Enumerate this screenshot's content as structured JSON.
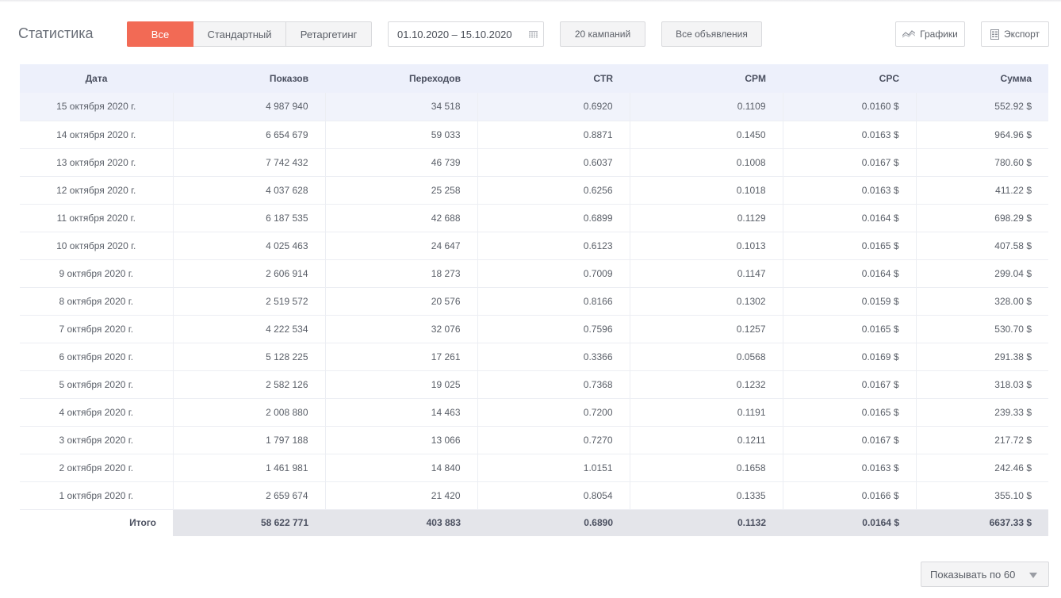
{
  "page_title": "Статистика",
  "filters": {
    "segments": [
      {
        "label": "Все",
        "active": true
      },
      {
        "label": "Стандартный",
        "active": false
      },
      {
        "label": "Ретаргетинг",
        "active": false
      }
    ],
    "date_range": "01.10.2020 – 15.10.2020",
    "campaigns_label": "20 кампаний",
    "ads_label": "Все объявления"
  },
  "toolbar": {
    "charts_label": "Графики",
    "export_label": "Экспорт"
  },
  "table": {
    "columns": [
      "Дата",
      "Показов",
      "Переходов",
      "CTR",
      "CPM",
      "CPC",
      "Сумма"
    ],
    "rows": [
      [
        "15 октября 2020 г.",
        "4 987 940",
        "34 518",
        "0.6920",
        "0.1109",
        "0.0160 $",
        "552.92 $"
      ],
      [
        "14 октября 2020 г.",
        "6 654 679",
        "59 033",
        "0.8871",
        "0.1450",
        "0.0163 $",
        "964.96 $"
      ],
      [
        "13 октября 2020 г.",
        "7 742 432",
        "46 739",
        "0.6037",
        "0.1008",
        "0.0167 $",
        "780.60 $"
      ],
      [
        "12 октября 2020 г.",
        "4 037 628",
        "25 258",
        "0.6256",
        "0.1018",
        "0.0163 $",
        "411.22 $"
      ],
      [
        "11 октября 2020 г.",
        "6 187 535",
        "42 688",
        "0.6899",
        "0.1129",
        "0.0164 $",
        "698.29 $"
      ],
      [
        "10 октября 2020 г.",
        "4 025 463",
        "24 647",
        "0.6123",
        "0.1013",
        "0.0165 $",
        "407.58 $"
      ],
      [
        "9 октября 2020 г.",
        "2 606 914",
        "18 273",
        "0.7009",
        "0.1147",
        "0.0164 $",
        "299.04 $"
      ],
      [
        "8 октября 2020 г.",
        "2 519 572",
        "20 576",
        "0.8166",
        "0.1302",
        "0.0159 $",
        "328.00 $"
      ],
      [
        "7 октября 2020 г.",
        "4 222 534",
        "32 076",
        "0.7596",
        "0.1257",
        "0.0165 $",
        "530.70 $"
      ],
      [
        "6 октября 2020 г.",
        "5 128 225",
        "17 261",
        "0.3366",
        "0.0568",
        "0.0169 $",
        "291.38 $"
      ],
      [
        "5 октября 2020 г.",
        "2 582 126",
        "19 025",
        "0.7368",
        "0.1232",
        "0.0167 $",
        "318.03 $"
      ],
      [
        "4 октября 2020 г.",
        "2 008 880",
        "14 463",
        "0.7200",
        "0.1191",
        "0.0165 $",
        "239.33 $"
      ],
      [
        "3 октября 2020 г.",
        "1 797 188",
        "13 066",
        "0.7270",
        "0.1211",
        "0.0167 $",
        "217.72 $"
      ],
      [
        "2 октября 2020 г.",
        "1 461 981",
        "14 840",
        "1.0151",
        "0.1658",
        "0.0163 $",
        "242.46 $"
      ],
      [
        "1 октября 2020 г.",
        "2 659 674",
        "21 420",
        "0.8054",
        "0.1335",
        "0.0166 $",
        "355.10 $"
      ]
    ],
    "total": [
      "Итого",
      "58 622 771",
      "403 883",
      "0.6890",
      "0.1132",
      "0.0164 $",
      "6637.33 $"
    ]
  },
  "pagination": {
    "per_page_label": "Показывать по 60"
  },
  "colors": {
    "accent": "#f26a55",
    "header_bg": "#edf0fb",
    "total_bg": "#e4e5ea"
  },
  "icons": {
    "calendar": "calendar-icon",
    "charts": "line-chart-icon",
    "export": "spreadsheet-icon",
    "dropdown": "caret-down-icon"
  }
}
